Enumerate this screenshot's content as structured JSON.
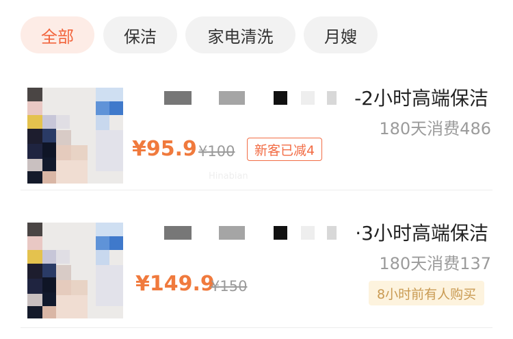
{
  "tabs": [
    {
      "label": "全部",
      "active": true
    },
    {
      "label": "保洁",
      "active": false
    },
    {
      "label": "家电清洗",
      "active": false
    },
    {
      "label": "月嫂",
      "active": false
    }
  ],
  "listings": [
    {
      "title_visible": "-2小时高端保洁",
      "sales": "180天消费486",
      "price": "¥95.9",
      "original_price": "¥100",
      "coupon": "新客已减4"
    },
    {
      "title_visible": "·3小时高端保洁",
      "sales": "180天消费137",
      "price": "¥149.9",
      "original_price": "¥150",
      "recent_purchase": "8小时前有人购买"
    }
  ],
  "colors": {
    "accent": "#f2643c",
    "price": "#f07a3d",
    "muted": "#9b9b9b",
    "recent_badge_bg": "#fdf3de",
    "recent_badge_text": "#c99a52"
  }
}
